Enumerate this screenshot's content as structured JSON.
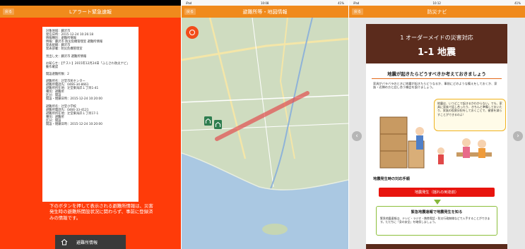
{
  "panel1": {
    "status": {
      "left": "iPad",
      "center": "",
      "right": ""
    },
    "back_label": "戻る",
    "title": "Lアラート緊急速報",
    "card_lines": [
      "対象地域：藤沢市",
      "発信日時：2015-12-24 10:26:18",
      "情報種別：避難所情報",
      "情報：藤沢市 防災危機管理室 避難所情報",
      "発表組織：藤沢市",
      "発表部署：防災危機管理室",
      "",
      "見出し文：藤沢市 避難所情報",
      "",
      "お知らせ：【テスト】2015年12月24日「ふじさわ防災ナビ」",
      "動作確認",
      "",
      "開設避難所数：2",
      "",
      "避難所名：辻堂市民センター",
      "避難所電話先：0466-34-8661",
      "避難所所在地：辻堂東海岸１丁目1-41",
      "種別：避難所",
      "区分：開設",
      "開設・閉鎖日時：2015-12-24 10:20:00",
      "",
      "避難所名：辻堂小学校",
      "避難所電話先：0466-33-4121",
      "避難所所在地：辻堂東海岸１丁目17-1",
      "種別：避難所",
      "区分：開設",
      "開設・閉鎖日時：2015-12-24 10:20:00"
    ],
    "note": "下のボタンを押して表示される避難所情報は、災害発生時の避難所開設状況に関わらず、事前に登録済みの情報です。",
    "shelter_button": "避難所情報"
  },
  "panel2": {
    "status": {
      "left": "iPad",
      "center": "10:08",
      "right": "41%"
    },
    "back_label": "戻る",
    "title": "避難所等・地図情報"
  },
  "panel3": {
    "status": {
      "left": "iPad",
      "center": "10:12",
      "right": "41%"
    },
    "back_label": "戻る",
    "title": "防災ナビ",
    "heading1": "1 オーダーメイドの災害対応",
    "heading2": "1-1 地震",
    "question": "地震が起きたらどうすべきか考えておきましょう",
    "paragraph": "家具がバラバラのときに地震が起きたらどうなるか、事前にどのような備えをしておくか、家族・近隣の方と話し合う機会を設けましょう。",
    "bubble_text": "地震は、いつどこで起きるかわからない。でも、家具に家族で話し合ったり、きちんと準備しておいたり、家族の役割分担をしておくことで、被害を減らすことができるのよ！",
    "section_title": "地震発生時の対応手順",
    "red_box": "地震発生（揺れの到達前）",
    "green_title": "緊急地震速報で地震発生を知る",
    "green_body": "緊急地震速報は、テレビ・ラジオ・携帯電話・防災行政無線などで入手することができます。ただちに「身の安全」を確保しましょう。",
    "prev_arrow": "‹",
    "next_arrow": "›"
  },
  "colors": {
    "alert_red": "#ff3b09",
    "nav_orange": "#f08a1c",
    "brown": "#5b2b1c",
    "route_red": "#e25050"
  }
}
